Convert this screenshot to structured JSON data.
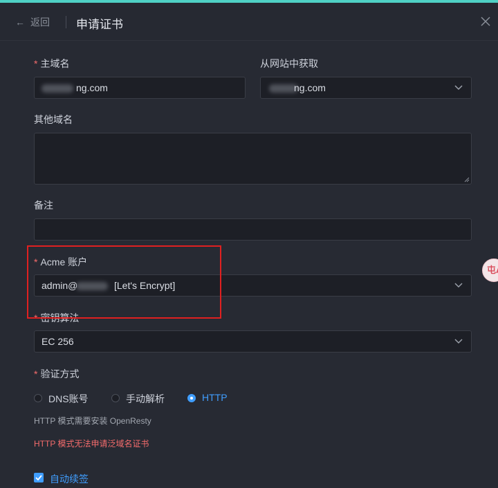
{
  "header": {
    "back_label": "返回",
    "title": "申请证书"
  },
  "form": {
    "primary_domain": {
      "label": "主域名",
      "value": "ng.com"
    },
    "from_website": {
      "label": "从网站中获取",
      "value": "ng.com"
    },
    "other_domains": {
      "label": "其他域名",
      "value": ""
    },
    "remark": {
      "label": "备注",
      "value": ""
    },
    "acme_account": {
      "label": "Acme 账户",
      "value_prefix": "admin@",
      "value_suffix": "[Let's Encrypt]"
    },
    "key_algorithm": {
      "label": "密钥算法",
      "value": "EC 256"
    },
    "verify_method": {
      "label": "验证方式",
      "options": [
        "DNS账号",
        "手动解析",
        "HTTP"
      ],
      "selected": "HTTP"
    },
    "http_hint": "HTTP 模式需要安装 OpenResty",
    "http_warning": "HTTP 模式无法申请泛域名证书",
    "auto_renew": {
      "label": "自动续签",
      "checked": true
    }
  },
  "side_widget": {
    "text": "屯A"
  },
  "colors": {
    "accent": "#409eff",
    "required": "#f56c6c",
    "highlight_box": "#e02020",
    "top_bar": "#4fd1c5"
  }
}
